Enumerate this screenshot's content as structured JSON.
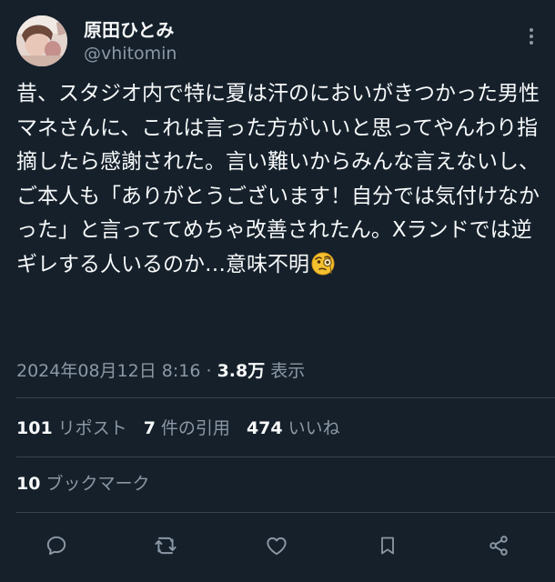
{
  "author": {
    "display_name": "原田ひとみ",
    "handle": "@vhitomin"
  },
  "tweet": {
    "text": "昔、スタジオ内で特に夏は汗のにおいがきつかった男性マネさんに、これは言った方がいいと思ってやんわり指摘したら感謝された。言い難いからみんな言えないし、ご本人も「ありがとうございます！自分では気付けなかった」と言っててめちゃ改善されたん。Xランドでは逆ギレする人いるのか…意味不明",
    "emoji": "face-with-monocle-icon"
  },
  "meta": {
    "datetime": "2024年08月12日 8:16",
    "separator": "·",
    "views": "3.8万",
    "views_label": "表示"
  },
  "stats": {
    "reposts": "101",
    "reposts_label": "リポスト",
    "quotes": "7",
    "quotes_label": "件の引用",
    "likes": "474",
    "likes_label": "いいね"
  },
  "bookmarks": {
    "count": "10",
    "label": "ブックマーク"
  },
  "actions": [
    "reply-icon",
    "repost-icon",
    "like-icon",
    "bookmark-icon",
    "share-icon"
  ],
  "colors": {
    "background": "#15202b",
    "text": "#f7f9f9",
    "secondary": "#8b98a5",
    "divider": "#38444d"
  }
}
